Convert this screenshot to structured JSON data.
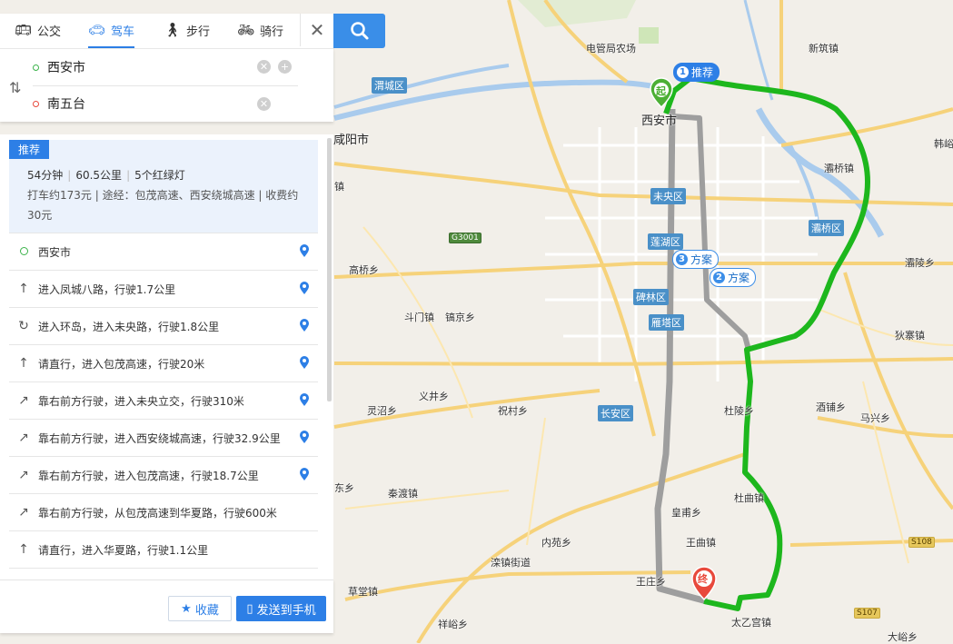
{
  "transport_tabs": [
    {
      "label": "公交",
      "icon": "bus-icon"
    },
    {
      "label": "驾车",
      "icon": "car-icon"
    },
    {
      "label": "步行",
      "icon": "walk-icon"
    },
    {
      "label": "骑行",
      "icon": "bike-icon"
    }
  ],
  "route_inputs": {
    "start": "西安市",
    "end": "南五台"
  },
  "summary": {
    "tag": "推荐",
    "duration": "54分钟",
    "distance": "60.5公里",
    "lights": "5个红绿灯",
    "detail": "打车约173元 | 途经：包茂高速、西安绕城高速 | 收费约30元"
  },
  "steps": [
    {
      "text": "西安市",
      "icon": "start-dot-icon"
    },
    {
      "text": "进入凤城八路，行驶1.7公里",
      "icon": "straight-arrow-icon"
    },
    {
      "text": "进入环岛，进入未央路，行驶1.8公里",
      "icon": "roundabout-icon"
    },
    {
      "text": "请直行，进入包茂高速，行驶20米",
      "icon": "straight-arrow-icon"
    },
    {
      "text": "靠右前方行驶，进入未央立交，行驶310米",
      "icon": "bear-right-icon"
    },
    {
      "text": "靠右前方行驶，进入西安绕城高速，行驶32.9公里",
      "icon": "bear-right-icon"
    },
    {
      "text": "靠右前方行驶，进入包茂高速，行驶18.7公里",
      "icon": "bear-right-icon"
    },
    {
      "text": "靠右前方行驶，从包茂高速到华夏路，行驶600米",
      "icon": "bear-right-icon"
    },
    {
      "text": "请直行，进入华夏路，行驶1.1公里",
      "icon": "straight-arrow-icon"
    }
  ],
  "footer": {
    "favorite": "收藏",
    "send": "发送到手机"
  },
  "map": {
    "route_bubbles": {
      "rec": "推荐",
      "plan2": "方案",
      "plan3": "方案",
      "rec_num": "1",
      "plan2_num": "2",
      "plan3_num": "3"
    },
    "markers": {
      "start": "起",
      "end": "终"
    },
    "districts": {
      "weicheng": "渭城区",
      "weiyang": "未央区",
      "lianhu": "莲湖区",
      "beilin": "碑林区",
      "yanta": "雁塔区",
      "baqiao": "灞桥区",
      "changan": "长安区"
    },
    "places": {
      "dianguanju": "电管局农场",
      "xinzhu": "新筑镇",
      "hanyu": "韩峪",
      "xianyang": "咸阳市",
      "xian": "西安市",
      "baqiaozhen": "灞桥镇",
      "gaoqiao": "高桥乡",
      "doumen": "斗门镇",
      "gaojing": "镐京乡",
      "baling": "灞陵乡",
      "dizhai": "狄寨镇",
      "lingzhao": "灵沼乡",
      "yijing": "义井乡",
      "zhucun": "祝村乡",
      "duling": "杜陵乡",
      "jiupu": "酒铺乡",
      "maxing": "马兴乡",
      "qindu": "秦渡镇",
      "huangfu": "皇甫乡",
      "duqu": "杜曲镇",
      "wangqu": "王曲镇",
      "neiyuan": "内苑乡",
      "luanzhen": "滦镇街道",
      "wangzhuang": "王庄乡",
      "caotang": "草堂镇",
      "xiangyu": "祥峪乡",
      "taiyigong": "太乙宫镇",
      "dayu": "大峪乡",
      "zhendong": "镇",
      "dongxiang": "东乡"
    },
    "roads": {
      "g3001": "G3001",
      "s108": "S108",
      "s107": "S107"
    }
  },
  "colors": {
    "accent": "#2d7fe6",
    "recommended_route": "#1db71d",
    "alt_route": "#9e9e9e"
  }
}
